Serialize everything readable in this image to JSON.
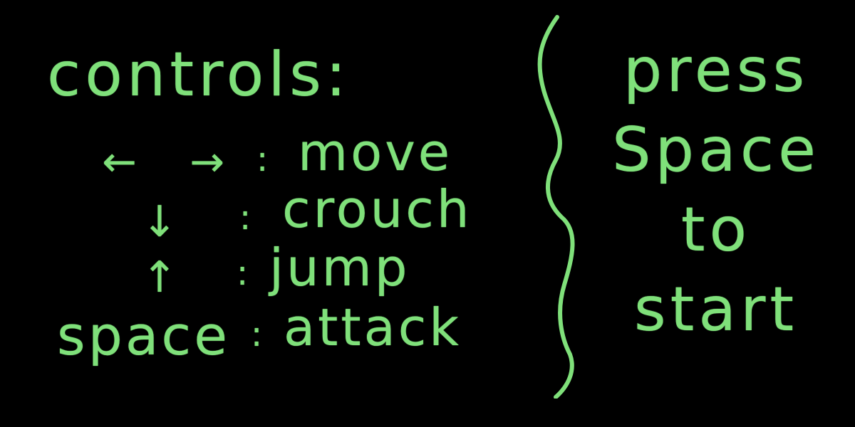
{
  "screen": {
    "background": "#000000",
    "ink_color": "#7fe07a"
  },
  "controls": {
    "heading": "controls:",
    "rows": [
      {
        "key": "← →",
        "separator": ":",
        "action": "move",
        "key_icon": "left-right-arrows-icon"
      },
      {
        "key": "↓",
        "separator": ":",
        "action": "crouch",
        "key_icon": "down-arrow-icon"
      },
      {
        "key": "↑",
        "separator": ":",
        "action": "jump",
        "key_icon": "up-arrow-icon"
      },
      {
        "key": "space",
        "separator": ":",
        "action": "attack"
      }
    ]
  },
  "divider": {
    "icon": "curly-brace-icon"
  },
  "start_prompt": {
    "lines": [
      "press",
      "Space",
      "to",
      "start"
    ]
  }
}
